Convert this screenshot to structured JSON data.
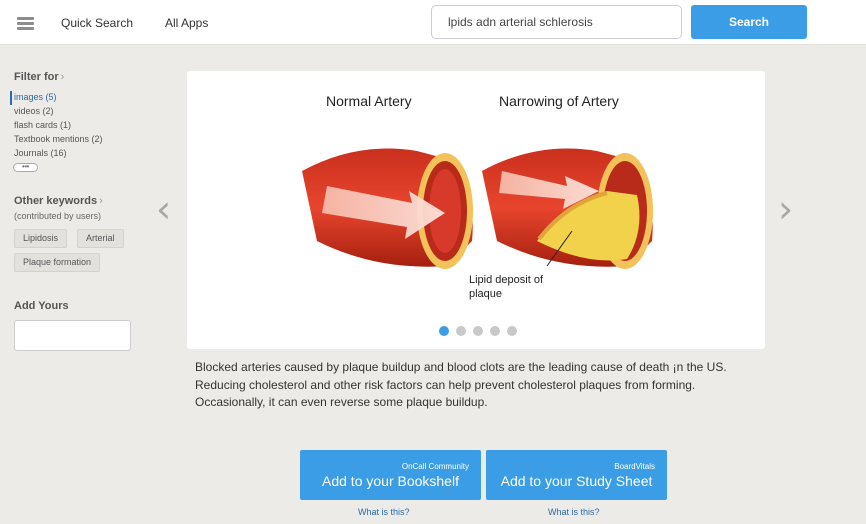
{
  "nav": {
    "menu_icon": "hamburger-menu-icon",
    "quick_search": "Quick Search",
    "all_apps": "All Apps",
    "search_value": "lpids adn arterial schlerosis",
    "search_button": "Search"
  },
  "sidebar": {
    "filter_heading": "Filter for",
    "filters": [
      {
        "label": "images (5)",
        "active": true
      },
      {
        "label": "videos (2)",
        "active": false
      },
      {
        "label": "flash cards (1)",
        "active": false
      },
      {
        "label": "Textbook mentions (2)",
        "active": false
      },
      {
        "label": "Journals (16)",
        "active": false
      }
    ],
    "more": "•••",
    "keywords_heading": "Other keywords",
    "contributed": "(contributed by users)",
    "tags": [
      "Lipidosis",
      "Arterial",
      "Plaque formation"
    ],
    "add_heading": "Add Yours",
    "add_value": ""
  },
  "carousel": {
    "label_left": "Normal Artery",
    "label_right": "Narrowing of Artery",
    "lipid_label": "Lipid deposit of plaque",
    "prev_icon": "chevron-left-icon",
    "next_icon": "chevron-right-icon",
    "slides": 5,
    "active_slide": 0
  },
  "description": "Blocked arteries caused by plaque buildup and blood clots are the leading cause of death ¡n the US. Reducing cholesterol and other risk factors can help prevent cholesterol plaques from forming. Occasionally, it can even reverse some plaque buildup.",
  "actions": [
    {
      "small": "OnCall Community",
      "big": "Add to your Bookshelf",
      "help": "What is this?"
    },
    {
      "small": "BoardVitals",
      "big": "Add to your Study Sheet",
      "help": "What is this?"
    }
  ],
  "colors": {
    "accent": "#3a9de5",
    "link": "#2a6aa8",
    "artery_red": "#d63a25",
    "plaque_yellow": "#f2d24a"
  }
}
